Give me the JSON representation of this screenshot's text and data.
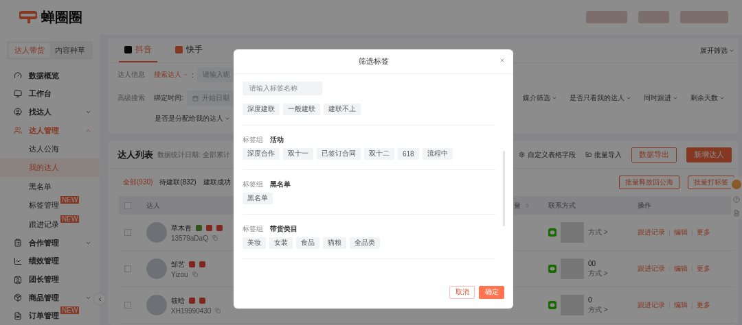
{
  "logo": {
    "text": "蝉圈圈"
  },
  "sidebar": {
    "modes": [
      {
        "label": "达人带货",
        "selected": true
      },
      {
        "label": "内容种草",
        "selected": false
      }
    ],
    "items": [
      {
        "label": "数据概览",
        "selected": false
      },
      {
        "label": "工作台",
        "selected": false
      },
      {
        "label": "找达人",
        "expanded": false,
        "selected": false
      },
      {
        "label": "达人管理",
        "expanded": true,
        "selected": true,
        "children": [
          {
            "label": "达人公海",
            "selected": false
          },
          {
            "label": "我的达人",
            "selected": true
          },
          {
            "label": "黑名单",
            "selected": false
          },
          {
            "label": "标签管理",
            "badge": "NEW",
            "selected": false
          },
          {
            "label": "跟进记录",
            "badge": "NEW",
            "selected": false
          }
        ]
      },
      {
        "label": "合作管理",
        "expanded": false,
        "selected": false
      },
      {
        "label": "绩效管理",
        "selected": false
      },
      {
        "label": "团长管理",
        "selected": false
      },
      {
        "label": "商品管理",
        "expanded": false,
        "selected": false
      },
      {
        "label": "订单管理",
        "badge": "NEW",
        "selected": false
      }
    ]
  },
  "platform_tabs": [
    {
      "label": "抖音",
      "selected": true
    },
    {
      "label": "快手",
      "selected": false
    }
  ],
  "expand_filter": "展开筛选",
  "filters": {
    "info_label": "达人信息",
    "search_type": "搜索达人",
    "search_type_suffix": ":",
    "search_placeholder": "请输入昵",
    "advanced_label": "高级搜索",
    "bind_time_label": "绑定时间:",
    "start_placeholder": "开始日期",
    "dropdowns": [
      "媒介筛选",
      "是否只看我的达人",
      "同时跟进",
      "剩余天数"
    ],
    "dropdowns_row2": [
      "是否是分配给我的达人"
    ]
  },
  "list": {
    "title": "达人列表",
    "stat_date": "数据统计日期: 全部累计",
    "actions": [
      "自定义表格字段",
      "批量导入"
    ],
    "export_button": "数据导出",
    "add_button": "新增达人",
    "status_tabs": [
      {
        "label": "全部(930)",
        "selected": true
      },
      {
        "label": "待建联(832)",
        "selected": false
      },
      {
        "label": "建联成功",
        "selected": false
      }
    ],
    "bulk_buttons": [
      "批量释放回公海",
      "批量打标签"
    ],
    "select_all_checked": false,
    "columns": [
      "达人",
      "量",
      "联系方式",
      "操作"
    ],
    "rows": [
      {
        "checked": false,
        "name": "草木青",
        "id": "13579aDaQ",
        "verified": true,
        "contact_sub": "方式 >",
        "actions": [
          "跟进记录",
          "编辑",
          "更多"
        ]
      },
      {
        "checked": false,
        "name": "邹艺",
        "id": "Yizou",
        "contact_tail": "00",
        "contact_sub": "方式 >",
        "actions": [
          "跟进记录",
          "编辑",
          "更多"
        ]
      },
      {
        "checked": false,
        "name": "筱晗",
        "id": "XH19990430",
        "contact_tail": "0",
        "contact_sub": "方式 >",
        "actions": [
          "跟进记录",
          "编辑",
          "更多"
        ]
      }
    ]
  },
  "dialog": {
    "title": "筛选标签",
    "search_placeholder": "请输入标签名称",
    "groups": [
      {
        "tags": [
          "深度建联",
          "一般建联",
          "建联不上"
        ]
      },
      {
        "label": "标签组",
        "name": "活动",
        "tags": [
          "深度合作",
          "双十一",
          "已签订合同",
          "双十二",
          "618",
          "流程中"
        ]
      },
      {
        "label": "标签组",
        "name": "黑名单",
        "tags": [
          "黑名单"
        ]
      },
      {
        "label": "标签组",
        "name": "带货类目",
        "tags": [
          "美妆",
          "女装",
          "食品",
          "猫粮",
          "全品类"
        ]
      }
    ],
    "cancel": "取消",
    "confirm": "确定"
  }
}
